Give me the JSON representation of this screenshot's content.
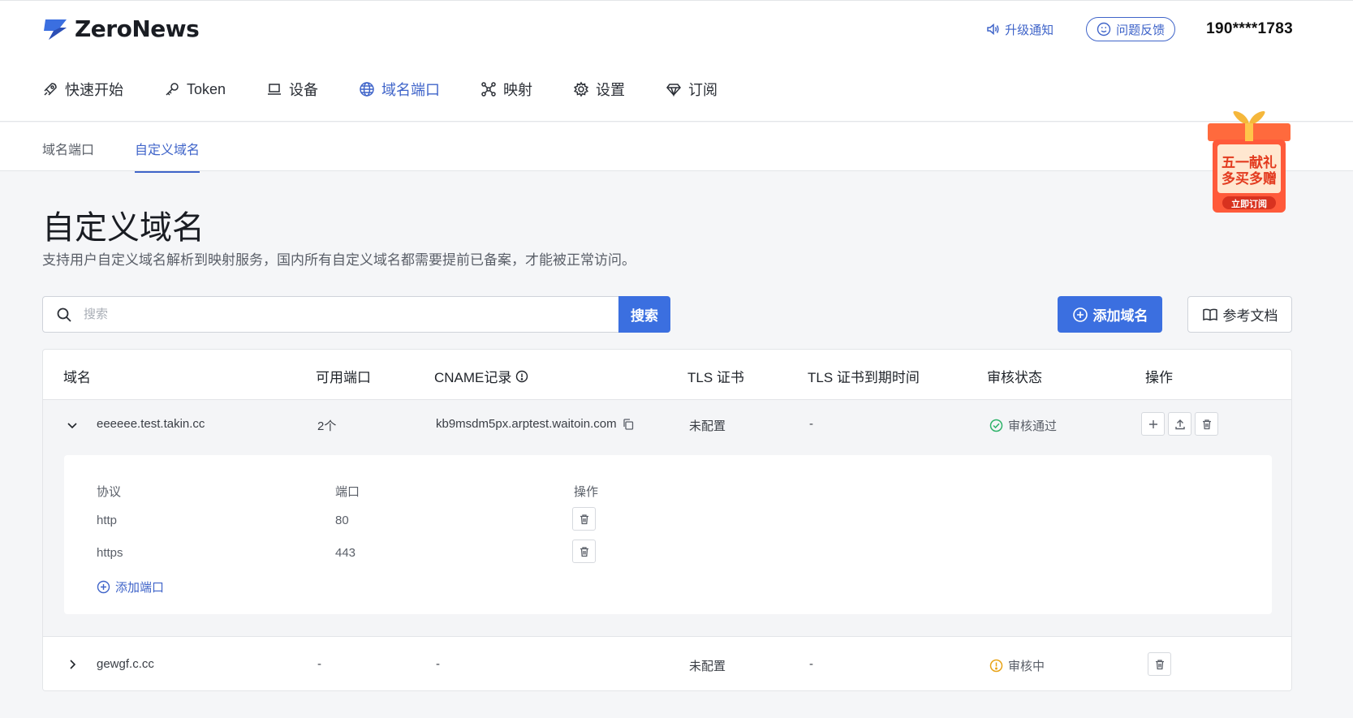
{
  "app": {
    "name": "ZeroNews",
    "phone": "190****1783"
  },
  "header": {
    "notice_label": "升级通知",
    "feedback_label": "问题反馈"
  },
  "nav": {
    "items": [
      {
        "label": "快速开始",
        "icon": "rocket-icon"
      },
      {
        "label": "Token",
        "icon": "key-icon"
      },
      {
        "label": "设备",
        "icon": "laptop-icon"
      },
      {
        "label": "域名端口",
        "icon": "globe-icon",
        "active": true
      },
      {
        "label": "映射",
        "icon": "network-icon"
      },
      {
        "label": "设置",
        "icon": "gear-icon"
      },
      {
        "label": "订阅",
        "icon": "diamond-icon"
      }
    ]
  },
  "subnav": {
    "tabs": [
      "域名端口",
      "自定义域名"
    ],
    "active": 1
  },
  "promo": {
    "line1": "五一献礼",
    "line2": "多买多赠",
    "cta": "立即订阅"
  },
  "page": {
    "title": "自定义域名",
    "description": "支持用户自定义域名解析到映射服务，国内所有自定义域名都需要提前已备案，才能被正常访问。"
  },
  "search": {
    "placeholder": "搜索",
    "button": "搜索"
  },
  "actions": {
    "add_domain": "添加域名",
    "docs": "参考文档"
  },
  "table": {
    "columns": [
      "域名",
      "可用端口",
      "CNAME记录",
      "TLS 证书",
      "TLS 证书到期时间",
      "审核状态",
      "操作"
    ],
    "rows": [
      {
        "domain": "eeeeee.test.takin.cc",
        "ports": "2个",
        "cname": "kb9msdm5px.arptest.waitoin.com",
        "tls": "未配置",
        "tls_expiry": "-",
        "status": "审核通过",
        "expanded": true
      },
      {
        "domain": "gewgf.c.cc",
        "ports": "-",
        "cname": "-",
        "tls": "未配置",
        "tls_expiry": "-",
        "status": "审核中",
        "expanded": false
      }
    ],
    "sub_table": {
      "columns": [
        "协议",
        "端口",
        "操作"
      ],
      "rows": [
        {
          "protocol": "http",
          "port": "80"
        },
        {
          "protocol": "https",
          "port": "443"
        }
      ],
      "add_port": "添加端口"
    }
  },
  "colors": {
    "accent": "#3b6fe0",
    "success": "#2fb36a",
    "warning": "#e8a317"
  }
}
